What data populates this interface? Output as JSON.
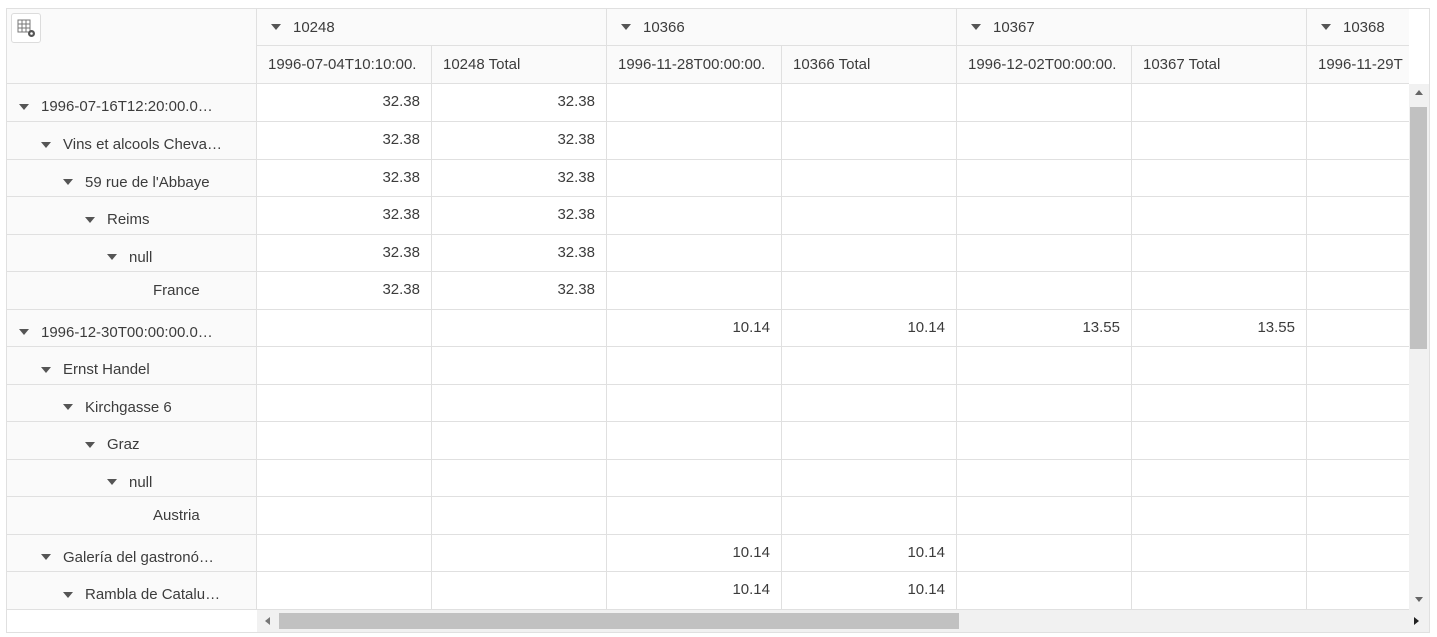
{
  "columns_level1": [
    {
      "label": "10248"
    },
    {
      "label": "10366"
    },
    {
      "label": "10367"
    },
    {
      "label": "10368"
    }
  ],
  "columns_level2": [
    {
      "label": "1996-07-04T10:10:00."
    },
    {
      "label": "10248 Total"
    },
    {
      "label": "1996-11-28T00:00:00."
    },
    {
      "label": "10366 Total"
    },
    {
      "label": "1996-12-02T00:00:00."
    },
    {
      "label": "10367 Total"
    },
    {
      "label": "1996-11-29T"
    }
  ],
  "rows": [
    {
      "label": "1996-07-16T12:20:00.0…",
      "expanded": true,
      "cells": [
        "32.38",
        "32.38",
        "",
        "",
        "",
        "",
        ""
      ]
    },
    {
      "label": "Vins et alcools Cheva…",
      "expanded": true,
      "cells": [
        "32.38",
        "32.38",
        "",
        "",
        "",
        "",
        ""
      ]
    },
    {
      "label": "59 rue de l'Abbaye",
      "expanded": true,
      "cells": [
        "32.38",
        "32.38",
        "",
        "",
        "",
        "",
        ""
      ]
    },
    {
      "label": "Reims",
      "expanded": true,
      "cells": [
        "32.38",
        "32.38",
        "",
        "",
        "",
        "",
        ""
      ]
    },
    {
      "label": "null",
      "expanded": true,
      "cells": [
        "32.38",
        "32.38",
        "",
        "",
        "",
        "",
        ""
      ]
    },
    {
      "label": "France",
      "expanded": false,
      "cells": [
        "32.38",
        "32.38",
        "",
        "",
        "",
        "",
        ""
      ]
    },
    {
      "label": "1996-12-30T00:00:00.0…",
      "expanded": true,
      "cells": [
        "",
        "",
        "10.14",
        "10.14",
        "13.55",
        "13.55",
        ""
      ]
    },
    {
      "label": "Ernst Handel",
      "expanded": true,
      "cells": [
        "",
        "",
        "",
        "",
        "",
        "",
        ""
      ]
    },
    {
      "label": "Kirchgasse 6",
      "expanded": true,
      "cells": [
        "",
        "",
        "",
        "",
        "",
        "",
        ""
      ]
    },
    {
      "label": "Graz",
      "expanded": true,
      "cells": [
        "",
        "",
        "",
        "",
        "",
        "",
        ""
      ]
    },
    {
      "label": "null",
      "expanded": true,
      "cells": [
        "",
        "",
        "",
        "",
        "",
        "",
        ""
      ]
    },
    {
      "label": "Austria",
      "expanded": false,
      "cells": [
        "",
        "",
        "",
        "",
        "",
        "",
        ""
      ]
    },
    {
      "label": "Galería del gastronó…",
      "expanded": true,
      "cells": [
        "",
        "",
        "10.14",
        "10.14",
        "",
        "",
        ""
      ]
    },
    {
      "label": "Rambla de Catalu…",
      "expanded": true,
      "cells": [
        "",
        "",
        "10.14",
        "10.14",
        "",
        "",
        ""
      ]
    }
  ],
  "icons": {
    "config": "grid-settings-icon",
    "expand": "caret-down-icon"
  },
  "colors": {
    "border": "#e0e0e0",
    "header_bg": "#fafafa",
    "scrollbar_thumb": "#c1c1c1",
    "text": "#3c3c3c"
  }
}
